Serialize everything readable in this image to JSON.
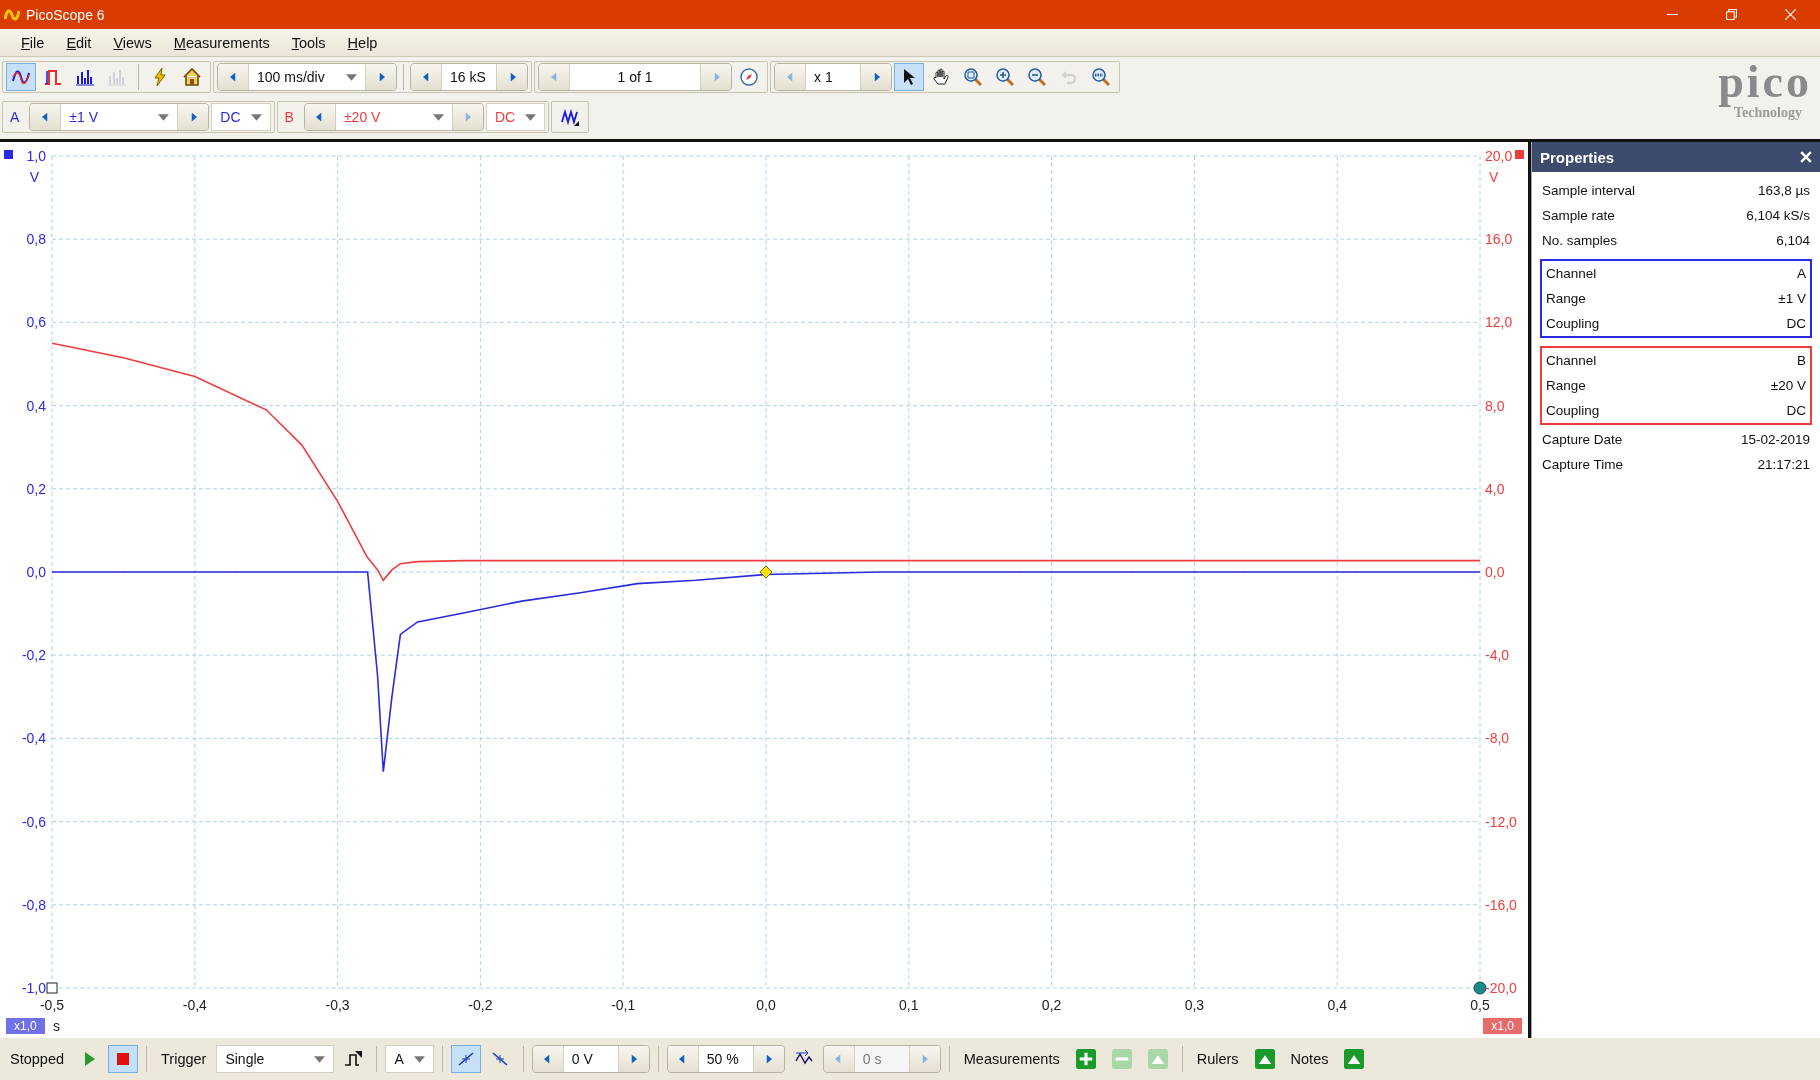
{
  "window": {
    "title": "PicoScope 6"
  },
  "menu": [
    "File",
    "Edit",
    "Views",
    "Measurements",
    "Tools",
    "Help"
  ],
  "toolbar": {
    "modes": [
      {
        "kind": "scope",
        "selected": true,
        "disabled": false
      },
      {
        "kind": "persistence",
        "selected": false,
        "disabled": false
      },
      {
        "kind": "spectrum",
        "selected": false,
        "disabled": false
      },
      {
        "kind": "spectrum",
        "selected": false,
        "disabled": true
      }
    ],
    "timebase": "100 ms/div",
    "samples": "16 kS",
    "buffer": "1 of 1",
    "zoom": "x 1",
    "tools": [
      {
        "kind": "pointer",
        "selected": true,
        "disabled": false
      },
      {
        "kind": "hand",
        "selected": false,
        "disabled": false
      },
      {
        "kind": "zoom-area",
        "selected": false,
        "disabled": false
      },
      {
        "kind": "zoom-in",
        "selected": false,
        "disabled": false
      },
      {
        "kind": "zoom-out",
        "selected": false,
        "disabled": false
      },
      {
        "kind": "undo",
        "selected": false,
        "disabled": true
      },
      {
        "kind": "zoom-fit",
        "selected": false,
        "disabled": false
      }
    ]
  },
  "logo": {
    "name": "pico",
    "tagline": "Technology"
  },
  "channels": [
    {
      "name": "A",
      "range": "±1 V",
      "coupling": "DC",
      "color": "#2a2ae0"
    },
    {
      "name": "B",
      "range": "±20 V",
      "coupling": "DC",
      "color": "#f03c3c"
    }
  ],
  "plot": {
    "left_unit": "V",
    "right_unit": "V",
    "x_unit": "s",
    "left_scale": "x1,0",
    "right_scale": "x1,0",
    "channel_a": {
      "chart_data": {
        "type": "line",
        "grid": true,
        "xlim": [
          -0.5,
          0.5
        ],
        "ylim": [
          -1,
          1
        ],
        "xticks": [
          {
            "value": -0.5,
            "label": "-0,5"
          },
          {
            "value": -0.4,
            "label": "-0,4"
          },
          {
            "value": -0.3,
            "label": "-0,3"
          },
          {
            "value": -0.2,
            "label": "-0,2"
          },
          {
            "value": -0.1,
            "label": "-0,1"
          },
          {
            "value": 0,
            "label": "0,0"
          },
          {
            "value": 0.1,
            "label": "0,1"
          },
          {
            "value": 0.2,
            "label": "0,2"
          },
          {
            "value": 0.3,
            "label": "0,3"
          },
          {
            "value": 0.4,
            "label": "0,4"
          },
          {
            "value": 0.5,
            "label": "0,5"
          }
        ],
        "yticks": [
          {
            "value": 1,
            "label": "1,0"
          },
          {
            "value": 0.8,
            "label": "0,8"
          },
          {
            "value": 0.6,
            "label": "0,6"
          },
          {
            "value": 0.4,
            "label": "0,4"
          },
          {
            "value": 0.2,
            "label": "0,2"
          },
          {
            "value": 0,
            "label": "0,0"
          },
          {
            "value": -0.2,
            "label": "-0,2"
          },
          {
            "value": -0.4,
            "label": "-0,4"
          },
          {
            "value": -0.6,
            "label": "-0,6"
          },
          {
            "value": -0.8,
            "label": "-0,8"
          },
          {
            "value": -1,
            "label": "-1,0"
          }
        ],
        "x": [
          -0.5,
          -0.45,
          -0.4,
          -0.35,
          -0.325,
          -0.3,
          -0.28,
          -0.279,
          -0.272,
          -0.268,
          -0.262,
          -0.256,
          -0.244,
          -0.211,
          -0.171,
          -0.13,
          -0.09,
          -0.049,
          0,
          0.08,
          0.2,
          0.35,
          0.5
        ],
        "series": [
          {
            "color": "#2a2ae0",
            "values": [
              0,
              0,
              0,
              0,
              0,
              0,
              0,
              0,
              -0.25,
              -0.48,
              -0.3,
              -0.15,
              -0.12,
              -0.098,
              -0.07,
              -0.05,
              -0.028,
              -0.02,
              -0.006,
              0,
              0,
              0,
              0
            ]
          }
        ]
      }
    },
    "channel_b": {
      "chart_data": {
        "type": "line",
        "xlim": [
          -0.5,
          0.5
        ],
        "ylim": [
          -20,
          20
        ],
        "yticks": [
          {
            "value": 20,
            "label": "20,0"
          },
          {
            "value": 16,
            "label": "16,0"
          },
          {
            "value": 12,
            "label": "12,0"
          },
          {
            "value": 8,
            "label": "8,0"
          },
          {
            "value": 4,
            "label": "4,0"
          },
          {
            "value": 0,
            "label": "0,0"
          },
          {
            "value": -4,
            "label": "-4,0"
          },
          {
            "value": -8,
            "label": "-8,0"
          },
          {
            "value": -12,
            "label": "-12,0"
          },
          {
            "value": -16,
            "label": "-16,0"
          },
          {
            "value": -20,
            "label": "-20,0"
          }
        ],
        "x": [
          -0.5,
          -0.45,
          -0.4,
          -0.35,
          -0.325,
          -0.3,
          -0.28,
          -0.279,
          -0.272,
          -0.268,
          -0.262,
          -0.256,
          -0.244,
          -0.211,
          -0.171,
          -0.13,
          -0.09,
          -0.049,
          0,
          0.08,
          0.2,
          0.35,
          0.5
        ],
        "series": [
          {
            "color": "#f03c3c",
            "values": [
              11.0,
              10.3,
              9.4,
              7.8,
              6.1,
              3.4,
              0.8,
              0.7,
              0.1,
              -0.4,
              0.1,
              0.4,
              0.5,
              0.55,
              0.55,
              0.55,
              0.55,
              0.55,
              0.55,
              0.55,
              0.55,
              0.55,
              0.55
            ]
          }
        ]
      }
    }
  },
  "properties": {
    "title": "Properties",
    "general": [
      {
        "label": "Sample interval",
        "value": "163,8 µs"
      },
      {
        "label": "Sample rate",
        "value": "6,104 kS/s"
      },
      {
        "label": "No. samples",
        "value": "6,104"
      }
    ],
    "channel_groups": [
      {
        "color": "#2a2ae0",
        "rows": [
          {
            "label": "Channel",
            "value": "A"
          },
          {
            "label": "Range",
            "value": "±1 V"
          },
          {
            "label": "Coupling",
            "value": "DC"
          }
        ]
      },
      {
        "color": "#f03c3c",
        "rows": [
          {
            "label": "Channel",
            "value": "B"
          },
          {
            "label": "Range",
            "value": "±20 V"
          },
          {
            "label": "Coupling",
            "value": "DC"
          }
        ]
      }
    ],
    "capture": [
      {
        "label": "Capture Date",
        "value": "15-02-2019"
      },
      {
        "label": "Capture Time",
        "value": "21:17:21"
      }
    ]
  },
  "status_bar": {
    "state": "Stopped",
    "running": false,
    "trigger_label": "Trigger",
    "trigger_mode": "Single",
    "source": "A",
    "rising_selected": true,
    "level": "0 V",
    "pretrigger": "50 %",
    "delay": "0 s",
    "measurements": "Measurements",
    "rulers": "Rulers",
    "notes": "Notes"
  }
}
